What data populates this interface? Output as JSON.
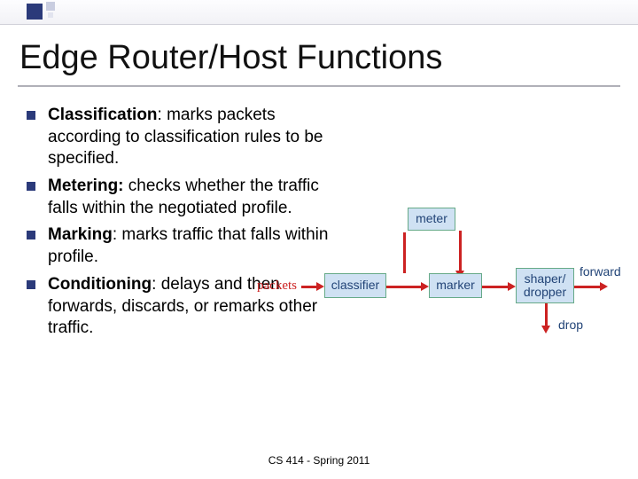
{
  "title": "Edge Router/Host Functions",
  "bullets": [
    {
      "term": "Classification",
      "body": ": marks packets according to classification rules to be specified."
    },
    {
      "term": "Metering:",
      "body": " checks whether the traffic falls within the negotiated profile."
    },
    {
      "term": "Marking",
      "body": ": marks traffic that falls within profile."
    },
    {
      "term": "Conditioning",
      "body": ": delays and then forwards, discards, or remarks other traffic."
    }
  ],
  "diagram": {
    "packets_label": "packets",
    "nodes": {
      "classifier": "classifier",
      "meter": "meter",
      "marker": "marker",
      "shaper_line1": "shaper/",
      "shaper_line2": "dropper"
    },
    "edges": {
      "forward": "forward",
      "drop": "drop"
    }
  },
  "footer": "CS 414 - Spring 2011"
}
